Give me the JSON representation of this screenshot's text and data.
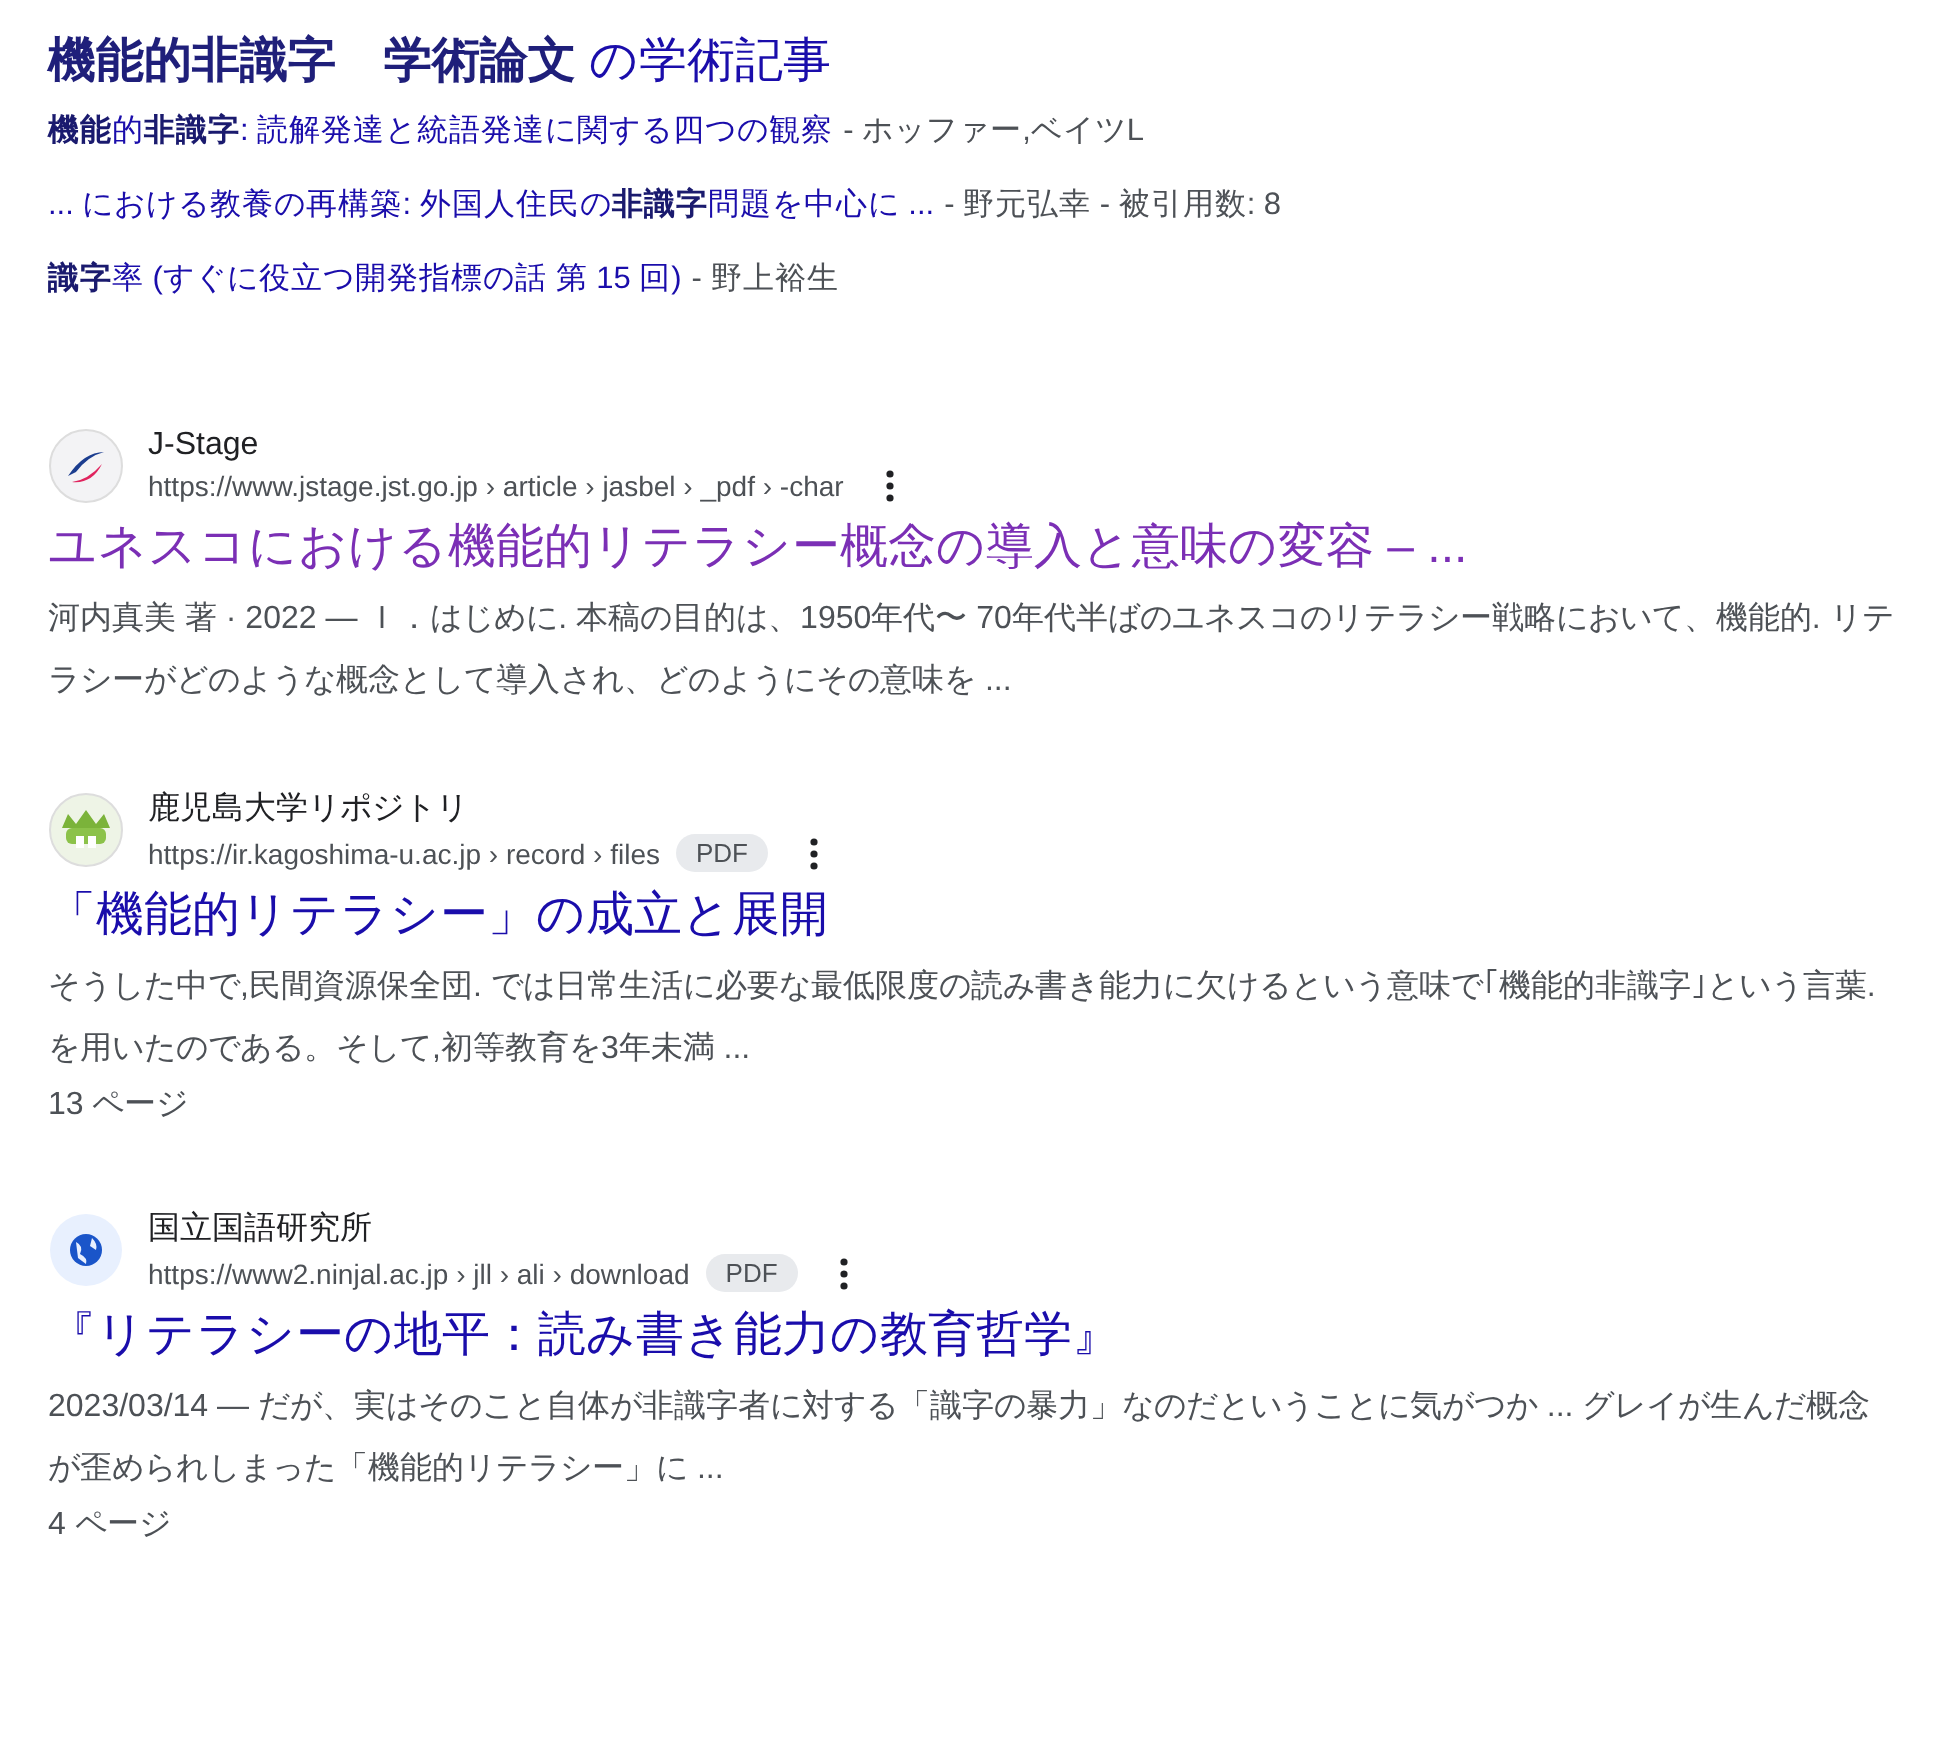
{
  "scholar": {
    "heading": "**機能的非識字　学術論文** の学術記事",
    "items": [
      {
        "link": "**機能**的**非識字**: 読解発達と統語発達に関する四つの観察",
        "meta": "- ホッファー,ベイツL"
      },
      {
        "link": "... における教養の再構築: 外国人住民の**非識字**問題を中心に ...",
        "meta": "- 野元弘幸 - 被引用数: 8"
      },
      {
        "link": "**識字**率 (すぐに役立つ開発指標の話 第 15 回)",
        "meta": "- 野上裕生"
      }
    ]
  },
  "results": [
    {
      "site": "J-Stage",
      "url": "https://www.jstage.jst.go.jp › article › jasbel › _pdf › -char",
      "title": "ユネスコにおける機能的リテラシー概念の導入と意味の変容 – ...",
      "visited": true,
      "snippet": "河内真美 著 · 2022 — Ｉ．はじめに. 本稿の目的は、1950年代〜 70年代半ばのユネスコのリテラシー戦略において、機能的. リテラシーがどのような概念として導入され、どのようにその意味を ..."
    },
    {
      "site": "鹿児島大学リポジトリ",
      "url": "https://ir.kagoshima-u.ac.jp › record › files",
      "badge": "PDF",
      "title": "「機能的リテラシー」の成立と展開",
      "visited": false,
      "snippet": "そうした中で,民間資源保全団. では日常生活に必要な最低限度の読み書き能力に欠けるという意味で｢機能的非識字｣という言葉. を用いたのである。そして,初等教育を3年未満 ...",
      "pages": "13 ページ"
    },
    {
      "site": "国立国語研究所",
      "url": "https://www2.ninjal.ac.jp › jll › ali › download",
      "badge": "PDF",
      "title": "『リテラシーの地平：読み書き能力の教育哲学』",
      "visited": false,
      "snippet": "2023/03/14 — だが、実はそのこと自体が非識字者に対する「識字の暴力」なのだということに気がつか ... グレイが生んだ概念が歪められしまった「機能的リテラシー」に ...",
      "pages": "4 ページ"
    }
  ]
}
